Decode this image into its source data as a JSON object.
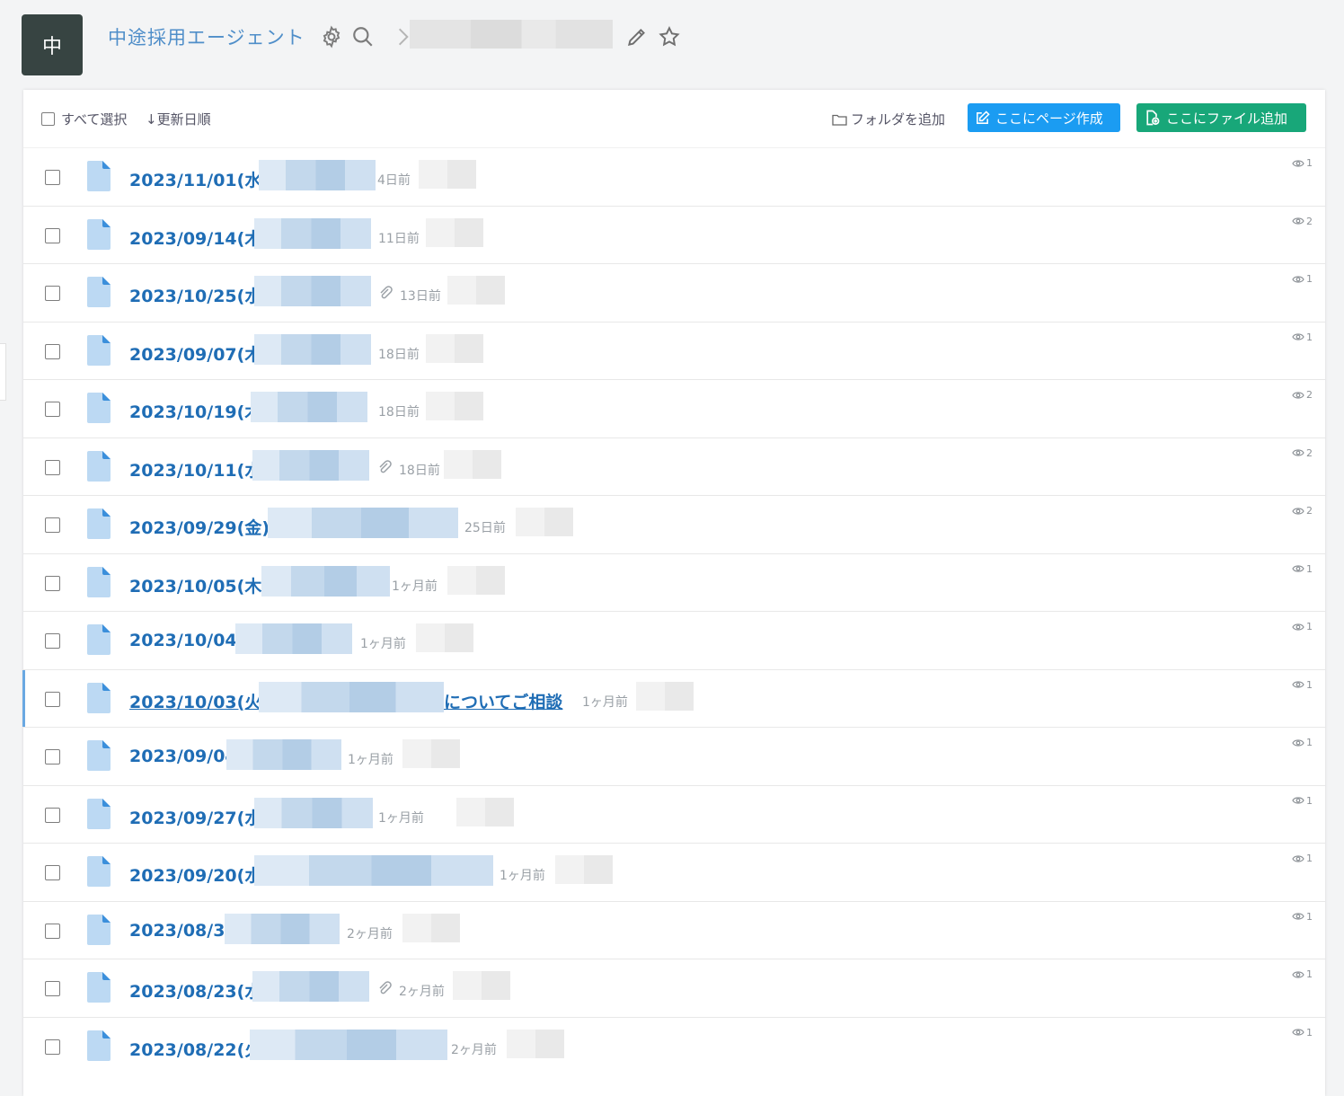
{
  "header": {
    "avatar_text": "中",
    "space_title": "中途採用エージェント"
  },
  "toolbar": {
    "select_all": "すべて選択",
    "sort_label": "↓更新日順",
    "add_folder": "フォルダを追加",
    "create_page": "ここにページ作成",
    "add_file": "ここにファイル追加",
    "create_page_color": "#1b9cf2",
    "add_file_color": "#18a779"
  },
  "rows": [
    {
      "title": "2023/11/01(水)",
      "time": "4日前",
      "views": "1",
      "attach": false
    },
    {
      "title": "2023/09/14(木)",
      "time": "11日前",
      "views": "2",
      "attach": false
    },
    {
      "title": "2023/10/25(水)",
      "time": "13日前",
      "views": "1",
      "attach": true
    },
    {
      "title": "2023/09/07(木)",
      "time": "18日前",
      "views": "1",
      "attach": false
    },
    {
      "title": "2023/10/19(木)",
      "time": "18日前",
      "views": "2",
      "attach": false
    },
    {
      "title": "2023/10/11(水)",
      "time": "18日前",
      "views": "2",
      "attach": true
    },
    {
      "title": "2023/09/29(金)",
      "time": "25日前",
      "views": "2",
      "attach": false
    },
    {
      "title": "2023/10/05(木)",
      "time": "1ヶ月前",
      "views": "1",
      "attach": false
    },
    {
      "title": "2023/10/04",
      "time": "1ヶ月前",
      "views": "1",
      "attach": false
    },
    {
      "title": "2023/10/03(火)",
      "suffix": "についてご相談",
      "time": "1ヶ月前",
      "views": "1",
      "attach": false,
      "active": true
    },
    {
      "title": "2023/09/04",
      "time": "1ヶ月前",
      "views": "1",
      "attach": false
    },
    {
      "title": "2023/09/27(水)",
      "time": "1ヶ月前",
      "views": "1",
      "attach": false
    },
    {
      "title": "2023/09/20(水)",
      "time": "1ヶ月前",
      "views": "1",
      "attach": false
    },
    {
      "title": "2023/08/30",
      "time": "2ヶ月前",
      "views": "1",
      "attach": false
    },
    {
      "title": "2023/08/23(水)",
      "time": "2ヶ月前",
      "views": "1",
      "attach": true
    },
    {
      "title": "2023/08/22(火)",
      "time": "2ヶ月前",
      "views": "1",
      "attach": false
    }
  ]
}
